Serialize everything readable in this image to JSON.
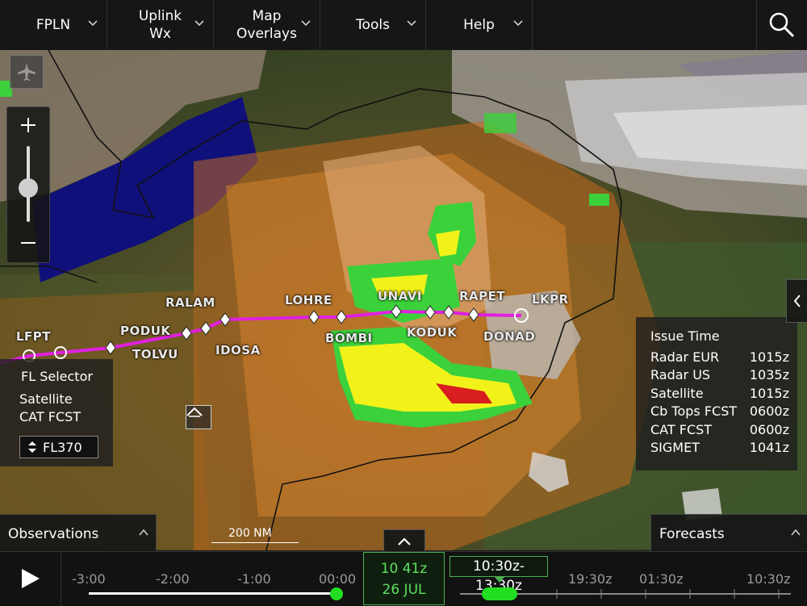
{
  "menu": {
    "fpln": "FPLN",
    "uplink": "Uplink\nWx",
    "overlays": "Map\nOverlays",
    "tools": "Tools",
    "help": "Help"
  },
  "waypoints": {
    "lfpt": "LFPT",
    "poduk": "PODUK",
    "tolvu": "TOLVU",
    "ralam": "RALAM",
    "idosa": "IDOSA",
    "lohre": "LOHRE",
    "bombi": "BOMBI",
    "unavi": "UNAVI",
    "koduk": "KODUK",
    "rapet": "RAPET",
    "donad": "DONAD",
    "lkpr": "LKPR"
  },
  "fl_panel": {
    "selector": "FL Selector",
    "satellite": "Satellite",
    "cat": "CAT FCST",
    "level": "FL370"
  },
  "issue_panel": {
    "title": "Issue Time",
    "rows": [
      {
        "name": "Radar EUR",
        "time": "1015z"
      },
      {
        "name": "Radar US",
        "time": "1035z"
      },
      {
        "name": "Satellite",
        "time": "1015z"
      },
      {
        "name": "Cb Tops FCST",
        "time": "0600z"
      },
      {
        "name": "CAT FCST",
        "time": "0600z"
      },
      {
        "name": "SIGMET",
        "time": "1041z"
      }
    ]
  },
  "scale": "200 NM",
  "tabs": {
    "observations": "Observations",
    "forecasts": "Forecasts"
  },
  "timeline": {
    "past_ticks": [
      "-3:00",
      "-2:00",
      "-1:00",
      "00:00"
    ],
    "current_time": "10 41z",
    "current_date": "26 JUL",
    "range": "10:30z-13:30z",
    "future_ticks": [
      "19:30z",
      "01:30z",
      "10:30z"
    ]
  },
  "colors": {
    "route": "#e020e0",
    "accent": "#4caf50",
    "radar_green": "#3bd13b",
    "radar_yellow": "#f2f21a",
    "radar_red": "#d81e1e"
  }
}
